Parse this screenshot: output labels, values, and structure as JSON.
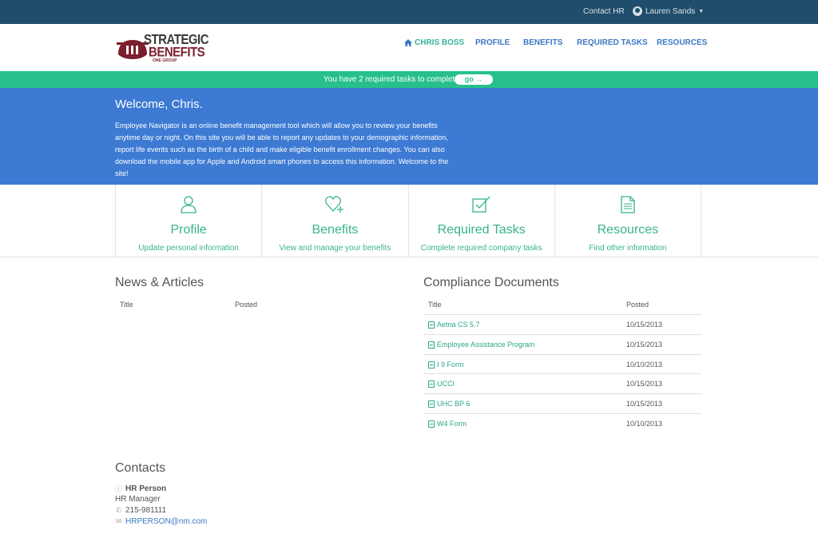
{
  "topbar": {
    "contact_label": "Contact HR",
    "user_name": "Lauren Sands"
  },
  "logo": {
    "line1": "STRATEGIC",
    "line2": "BENEFITS",
    "line3": "ONE GROUP"
  },
  "nav": {
    "items": [
      {
        "label": "CHRIS BOSS",
        "icon": "home-icon",
        "active": true
      },
      {
        "label": "PROFILE"
      },
      {
        "label": "BENEFITS"
      },
      {
        "label": "REQUIRED TASKS"
      },
      {
        "label": "RESOURCES"
      }
    ]
  },
  "banner": {
    "message": "You have 2 required tasks to complete",
    "go_label": "go →"
  },
  "welcome": {
    "title": "Welcome, Chris.",
    "body": "Employee Navigator is an online benefit management tool which will allow you to review your benefits anytime day or night.  On this site you will be able to report any updates to your demographic information, report life events such as the birth of a child and make eligible benefit enrollment changes.  You can also download the mobile app for Apple and Android smart phones to access this information.  Welcome to the site!"
  },
  "tiles": [
    {
      "title": "Profile",
      "subtitle": "Update personal information",
      "icon": "person-icon"
    },
    {
      "title": "Benefits",
      "subtitle": "View and manage your benefits",
      "icon": "heart-plus-icon"
    },
    {
      "title": "Required Tasks",
      "subtitle": "Complete required company tasks",
      "icon": "checkbox-icon"
    },
    {
      "title": "Resources",
      "subtitle": "Find other information",
      "icon": "document-icon"
    }
  ],
  "news": {
    "title": "News & Articles",
    "col_title": "Title",
    "col_posted": "Posted"
  },
  "compliance": {
    "title": "Compliance Documents",
    "col_title": "Title",
    "col_posted": "Posted",
    "rows": [
      {
        "name": "Aetna CS 5.7",
        "date": "10/15/2013"
      },
      {
        "name": "Employee Assistance Program",
        "date": "10/15/2013"
      },
      {
        "name": "I 9 Form",
        "date": "10/10/2013"
      },
      {
        "name": "UCCI",
        "date": "10/15/2013"
      },
      {
        "name": "UHC BP 6",
        "date": "10/15/2013"
      },
      {
        "name": "W4 Form",
        "date": "10/10/2013"
      }
    ]
  },
  "contacts": {
    "title": "Contacts",
    "name": "HR Person",
    "role": "HR Manager",
    "phone": "215-981111",
    "email": "HRPERSON@nm.com"
  },
  "colors": {
    "topbar": "#1f4d6b",
    "banner": "#27c08a",
    "welcome": "#3d7ad3",
    "accent": "#37b38f",
    "nav": "#3b78c4"
  }
}
